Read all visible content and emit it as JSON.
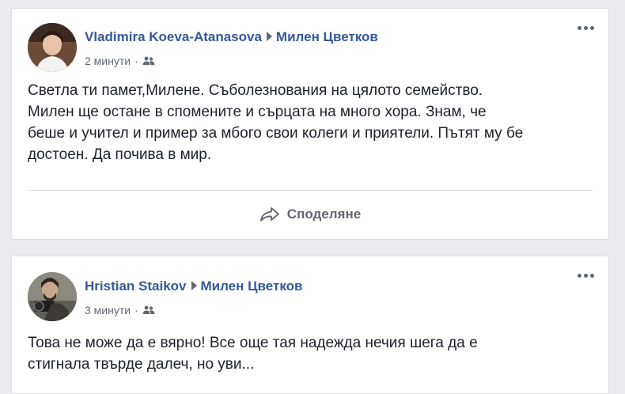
{
  "posts": [
    {
      "author": "Vladimira Koeva-Atanasova",
      "target": "Милен Цветков",
      "time": "2 минути",
      "separator": "·",
      "audience_icon": "friends-icon",
      "lines": [
        "Светла ти памет,Милене. Съболезнования на цялото семейство.",
        "Милен ще остане в спомените и сърцата на много хора. Знам, че",
        "беше и учител и пример за мбого свои колеги и приятели. Пътят му бе",
        "достоен. Да почива в мир."
      ],
      "share_label": "Споделяне",
      "share_icon": "share-arrow-icon",
      "more_icon": "more-options-icon"
    },
    {
      "author": "Hristian Staikov",
      "target": "Милен Цветков",
      "time": "3 минути",
      "separator": "·",
      "audience_icon": "friends-icon",
      "lines": [
        "Това не може да е вярно! Все още тая надежда нечия шега да е",
        "стигнала твърде далеч, но уви..."
      ],
      "more_icon": "more-options-icon"
    }
  ],
  "colors": {
    "page_background": "#e9ebee",
    "link": "#365899",
    "meta": "#606770",
    "text": "#1d2129"
  }
}
